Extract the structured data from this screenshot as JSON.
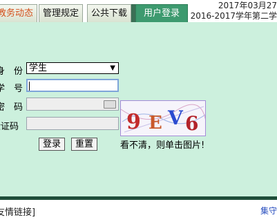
{
  "tabs": [
    {
      "label": "教务动态",
      "active": false
    },
    {
      "label": "管理规定",
      "active": false
    },
    {
      "label": "公共下载",
      "active": false
    },
    {
      "label": "用户登录",
      "active": true
    }
  ],
  "header": {
    "date": "2017年03月27",
    "term": "2016-2017学年第二学"
  },
  "login": {
    "identity_label": "身　份",
    "identity_value": "学生",
    "student_id_label": "学　号",
    "password_label": "密　码",
    "captcha_label": "验证码",
    "captcha_text": "9EV6",
    "login_button": "登录",
    "reset_button": "重置",
    "captcha_hint": "看不清，则单击图片!"
  },
  "footer": {
    "links_label": "友情链接]",
    "right_text": "集守"
  },
  "colors": {
    "main_bg": "#ccf0dd",
    "active_tab": "#3d9a6f",
    "footer_bar": "#1f4e3a"
  }
}
